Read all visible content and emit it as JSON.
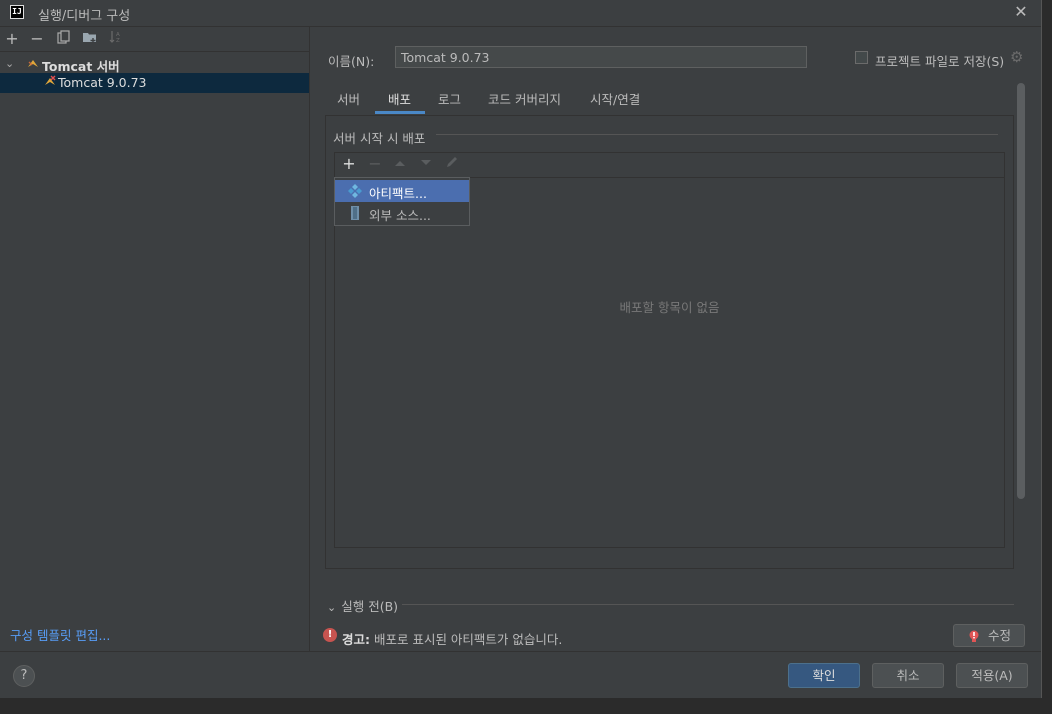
{
  "window": {
    "title": "실행/디버그 구성",
    "app_icon": "IJ"
  },
  "left_toolbar": {
    "add": "+",
    "remove": "−",
    "icons": [
      "add-icon",
      "remove-icon",
      "copy-icon",
      "folder-icon",
      "sort-icon"
    ]
  },
  "tree": {
    "group_label": "Tomcat 서버",
    "item_label": "Tomcat 9.0.73"
  },
  "edit_templates": "구성 템플릿 편집...",
  "name_field": {
    "label": "이름(N):",
    "value": "Tomcat 9.0.73"
  },
  "store_as_project_file": "프로젝트 파일로 저장(S)",
  "tabs": [
    {
      "label": "서버"
    },
    {
      "label": "배포"
    },
    {
      "label": "로그"
    },
    {
      "label": "코드 커버리지"
    },
    {
      "label": "시작/연결"
    }
  ],
  "active_tab": "배포",
  "deploy": {
    "section_title": "서버 시작 시 배포",
    "add": "+",
    "remove": "−",
    "empty_text": "배포할 항목이 없음"
  },
  "popup": {
    "items": [
      {
        "label": "아티팩트...",
        "icon": "artifact-icon"
      },
      {
        "label": "외부 소스...",
        "icon": "external-source-icon"
      }
    ]
  },
  "before_launch": "실행 전(B)",
  "warning": {
    "prefix": "경고:",
    "message": "배포로 표시된 아티팩트가 없습니다."
  },
  "fix_button": "수정",
  "buttons": {
    "help": "?",
    "ok": "확인",
    "cancel": "취소",
    "apply": "적용(A)"
  },
  "colors": {
    "accent": "#4a88c7",
    "selection": "#4b6eaf",
    "primary_button": "#365880",
    "warning": "#c75450",
    "link": "#589df6"
  }
}
